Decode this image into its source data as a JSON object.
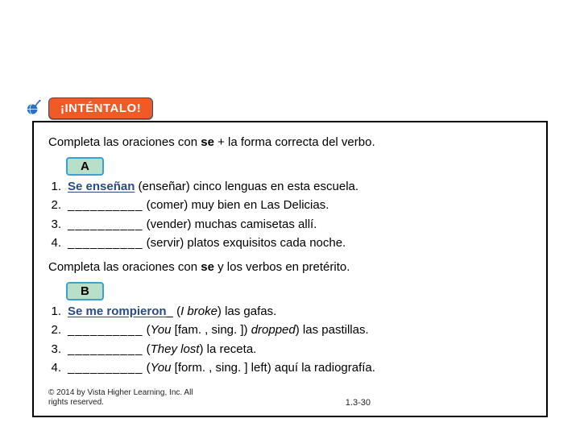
{
  "banner": {
    "label": "¡INTÉNTALO!"
  },
  "sectionA": {
    "label": "A",
    "instruction_pre": "Completa las oraciones con ",
    "instruction_bold": "se",
    "instruction_post": " + la forma correcta del verbo.",
    "items": [
      {
        "n": "1.",
        "answer": "Se  enseñan",
        "verb": "(enseñar)",
        "rest": " cinco lenguas en esta escuela."
      },
      {
        "n": "2.",
        "answer": "__________",
        "verb": "(comer)",
        "rest": " muy bien en Las Delicias."
      },
      {
        "n": "3.",
        "answer": "__________",
        "verb": "(vender)",
        "rest": " muchas camisetas allí."
      },
      {
        "n": "4.",
        "answer": "__________",
        "verb": "(servir)",
        "rest": " platos exquisitos cada noche."
      }
    ]
  },
  "sectionB": {
    "label": "B",
    "instruction_pre": "Completa las oraciones con ",
    "instruction_bold": "se",
    "instruction_post": " y los verbos en pretérito.",
    "items": [
      {
        "n": "1.",
        "answer": "Se me rompieron",
        "hint": "I broke",
        "rest": ") las gafas."
      },
      {
        "n": "2.",
        "answer": "__________",
        "hint": "You",
        "hint2": " [fam. , sing. ]) ",
        "hint3": "dropped",
        "rest": ") las pastillas."
      },
      {
        "n": "3.",
        "answer": "__________",
        "hint": "They lost",
        "rest": ") la receta."
      },
      {
        "n": "4.",
        "answer": "__________",
        "hint": "You",
        "hint2": " [form. , sing. ] left",
        "rest": ") aquí la radiografía."
      }
    ]
  },
  "footer": {
    "copyright": "© 2014 by Vista Higher Learning, Inc. All rights reserved.",
    "page": "1.3-30"
  }
}
